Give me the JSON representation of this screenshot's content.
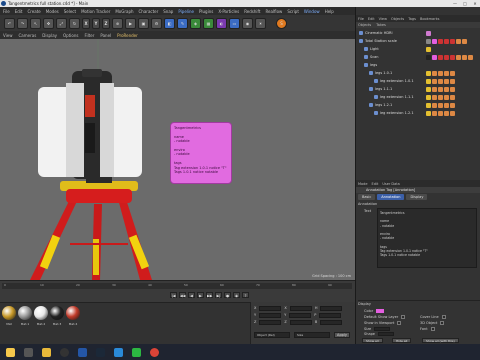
{
  "window": {
    "title": "Tangentmetrics full station.c4d *] - Main",
    "controls": [
      "—",
      "□",
      "✕"
    ]
  },
  "menubar": {
    "items": [
      "File",
      "Edit",
      "Create",
      "Modes",
      "Select",
      "Motion Tracker",
      "MoGraph",
      "Character",
      "Snap",
      "Pipeline",
      "Plugins",
      "X-Particles",
      "Redshift",
      "Realflow",
      "Script",
      "Window",
      "Help"
    ],
    "highlighted": [
      "Pipeline",
      "Window"
    ]
  },
  "viewport": {
    "menu": [
      "View",
      "Cameras",
      "Display",
      "Options",
      "Filter",
      "Panel",
      "ProRender"
    ],
    "menu_highlight": "ProRender",
    "grid_label": "Grid Spacing : 100 cm",
    "tooltip": {
      "lines": [
        "Tangentmetrics",
        "",
        "name",
        "- notable",
        "",
        "enviro",
        "- notable",
        "",
        "tags",
        "Tag extension 1.0.1 notice \"T\"",
        "Tags 1.0.1 notice notable"
      ]
    }
  },
  "timeline": {
    "ticks": [
      "0",
      "10",
      "20",
      "30",
      "40",
      "50",
      "60",
      "70",
      "80",
      "90"
    ],
    "controls": [
      "|◀",
      "◀◀",
      "◀",
      "▶",
      "▶▶",
      "▶|",
      "●",
      "◉",
      "?"
    ]
  },
  "materials": {
    "items": [
      {
        "label": "Mat",
        "color": "#c99a28"
      },
      {
        "label": "Mat.1",
        "color": "#9a9a9a"
      },
      {
        "label": "Mat.2",
        "color": "#e8e8e8"
      },
      {
        "label": "Mat.3",
        "color": "#222222"
      },
      {
        "label": "Mat.4",
        "color": "#c23b2a"
      }
    ]
  },
  "coords": {
    "rows": [
      {
        "label": "X",
        "label2": "X",
        "label3": "H"
      },
      {
        "label": "Y",
        "label2": "Y",
        "label3": "P"
      },
      {
        "label": "Z",
        "label2": "Z",
        "label3": "B"
      }
    ],
    "mode_left": "Object (Rel)",
    "mode_right": "Size",
    "apply_label": "Apply"
  },
  "object_manager": {
    "menu": [
      "File",
      "Edit",
      "View",
      "Objects",
      "Tags",
      "Bookmarks"
    ],
    "tabs": [
      "Objects",
      "Takes"
    ],
    "rows": [
      {
        "name": "Cinematic HDRI",
        "depth": 0,
        "tags": [
          "#d07ad0"
        ]
      },
      {
        "name": "Total Station scale",
        "depth": 0,
        "tags": [
          "#888888",
          "#e35fe0",
          "#c33",
          "#c33",
          "#c33",
          "#d84",
          "#d84"
        ]
      },
      {
        "name": "Light",
        "depth": 1,
        "tags": [
          "#e4c030"
        ]
      },
      {
        "name": "Scan",
        "depth": 1,
        "tags": [
          "#222",
          "#e35fe0",
          "#c33",
          "#c33",
          "#c33",
          "#d84",
          "#d84",
          "#d84"
        ]
      },
      {
        "name": "legs",
        "depth": 1,
        "tags": []
      },
      {
        "name": "legs 1.0.1",
        "depth": 2,
        "tags": [
          "#e4c030",
          "#d84",
          "#d84",
          "#d84",
          "#d84"
        ]
      },
      {
        "name": "leg extension 1.0.1",
        "depth": 3,
        "tags": [
          "#e4c030",
          "#d84",
          "#d84",
          "#d84",
          "#d84"
        ]
      },
      {
        "name": "legs 1.1.1",
        "depth": 2,
        "tags": [
          "#e4c030",
          "#d84",
          "#d84",
          "#d84",
          "#d84"
        ]
      },
      {
        "name": "leg extension 1.1.1",
        "depth": 3,
        "tags": [
          "#e4c030",
          "#d84",
          "#d84",
          "#d84",
          "#d84"
        ]
      },
      {
        "name": "legs 1.2.1",
        "depth": 2,
        "tags": [
          "#e4c030",
          "#d84",
          "#d84",
          "#d84",
          "#d84"
        ]
      },
      {
        "name": "leg extension 1.2.1",
        "depth": 3,
        "tags": [
          "#e4c030",
          "#d84",
          "#d84",
          "#d84",
          "#d84"
        ]
      }
    ]
  },
  "attributes": {
    "menu": [
      "Mode",
      "Edit",
      "User Data"
    ],
    "title": "Annotation Tag [Annotation]",
    "tabs": [
      "Basic",
      "Annotation",
      "Display"
    ],
    "active_tab": "Annotation",
    "section": "Annotation",
    "text_label": "Text",
    "text_lines": [
      "Tangentmetrics",
      "",
      "name",
      "- notable",
      "",
      "enviro",
      "- notable",
      "",
      "tags",
      "Tag extension 1.0.1 notice \"T\"",
      "Tags 1.0.1 notice notable"
    ],
    "display_section": "Display",
    "display": {
      "color_label": "Color",
      "color": "#e35fe0",
      "url_label": "Default Show Layer",
      "url2_label": "Cover Line",
      "show_vp": "Show in Viewport",
      "size_label": "Size",
      "shape_label": "Shape",
      "background_label": "3D Object",
      "font_label": "Font",
      "opacity_label": "Opacity"
    },
    "buttons": [
      "Show all",
      "Hide all",
      "Show all (with this)"
    ]
  },
  "taskbar": {
    "icons": [
      "start-icon",
      "search-icon",
      "explorer-icon",
      "obs-icon",
      "c4d-icon",
      "steam-icon",
      "vscode-icon",
      "whatsapp-icon",
      "chrome-icon"
    ],
    "clock": ""
  }
}
